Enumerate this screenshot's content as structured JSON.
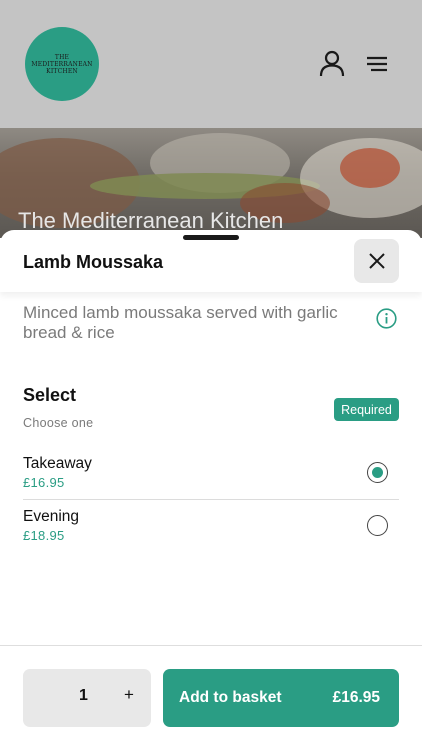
{
  "header": {
    "logo_lines": [
      "The",
      "Mediterranean",
      "Kitchen"
    ],
    "account_icon": "user-icon",
    "menu_icon": "hamburger-menu-icon"
  },
  "hero": {
    "restaurant_name": "The Mediterranean Kitchen"
  },
  "item": {
    "title": "Lamb Moussaka",
    "description": "Minced lamb moussaka served with garlic bread & rice",
    "close_icon": "close-icon",
    "info_icon": "info-icon"
  },
  "options_group": {
    "title": "Select",
    "subtitle": "Choose one",
    "badge": "Required",
    "options": [
      {
        "name": "Takeaway",
        "price": "£16.95",
        "selected": true
      },
      {
        "name": "Evening",
        "price": "£18.95",
        "selected": false
      }
    ]
  },
  "footer": {
    "quantity": "1",
    "plus_label": "+",
    "add_label": "Add to basket",
    "total": "£16.95"
  },
  "colors": {
    "accent": "#2a9d84",
    "overlay_header": "#c4c4c4",
    "muted_text": "#7a7a7a"
  }
}
